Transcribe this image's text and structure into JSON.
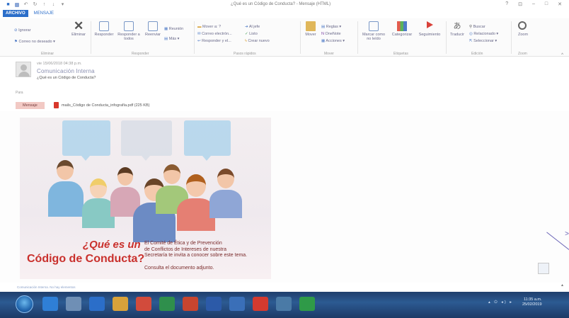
{
  "window": {
    "title": "¿Qué es un Código de Conducta? - Mensaje (HTML)",
    "controls": [
      "?",
      "⊡",
      "–",
      "□",
      "✕"
    ]
  },
  "tabs": [
    {
      "label": "ARCHIVO",
      "active": false
    },
    {
      "label": "MENSAJE",
      "active": true
    }
  ],
  "ribbon": {
    "ignore": "Ignorar",
    "junk": "Correo no deseado ▾",
    "delete": "Eliminar",
    "reply": "Responder",
    "reply_all": "Responder a todos",
    "forward": "Reenviar",
    "meeting": "Reunión",
    "more": "Más ▾",
    "move_to": "Mover a: ?",
    "email_team": "Correo electrón...",
    "reply_delete": "Responder y el...",
    "to_manager": "Al jefe",
    "done": "Listo",
    "create_new": "Crear nuevo",
    "move": "Mover",
    "rules": "Reglas ▾",
    "onenote": "OneNote",
    "actions": "Acciones ▾",
    "mark_unread": "Marcar como no leído",
    "categorize": "Categorizar",
    "follow_up": "Seguimiento",
    "translate": "Traducir",
    "find": "Buscar",
    "related": "Relacionado ▾",
    "select": "Seleccionar ▾",
    "zoom": "Zoom",
    "groups": [
      "Eliminar",
      "Responder",
      "Pasos rápidos",
      "Mover",
      "Etiquetas",
      "Edición",
      "Zoom"
    ],
    "collapse": "^"
  },
  "message": {
    "date": "vie 15/06/2018 04:38 p.m.",
    "sender": "Comunicación Interna",
    "subject": "¿Qué es un Código de Conducta?",
    "to_label": "Para"
  },
  "attachments": {
    "message_tab": "Mensaje",
    "file": "mails_Código de Conducta_infografía.pdf (225 KB)"
  },
  "infographic": {
    "question_line1": "¿Qué es un",
    "question_line2": "Código de Conducta?",
    "body_line1": "El Comité de Ética y de Prevención",
    "body_line2": "de Conflictos de Intereses de nuestra",
    "body_line3": "Secretaría te invita a conocer sobre este tema.",
    "footer": "Consulta el documento adjunto."
  },
  "status": {
    "text": "Comunicación Interna. No hay elementos",
    "scroll_arrow": "▴"
  },
  "taskbar": {
    "tray": "▴ ⏻ ◂) ▸",
    "time": "11:35 a.m.",
    "date": "25/02/2019"
  },
  "colors": {
    "accent": "#2b6ec9",
    "headline": "#c9302c",
    "taskbar": "#1f3e6c"
  }
}
